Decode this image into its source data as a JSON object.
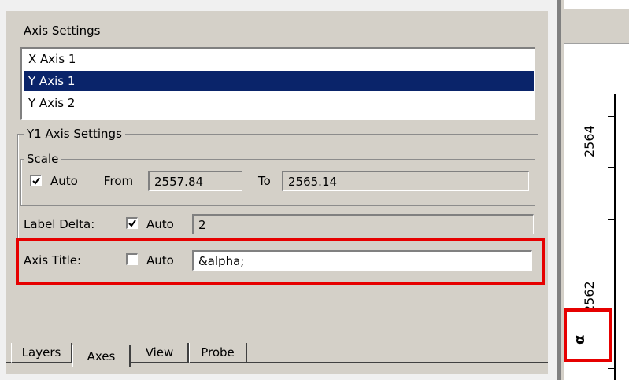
{
  "panel": {
    "title": "Axis Settings",
    "axis_list": [
      {
        "label": "X Axis 1",
        "selected": false
      },
      {
        "label": "Y Axis 1",
        "selected": true
      },
      {
        "label": "Y Axis 2",
        "selected": false
      }
    ]
  },
  "y1_settings": {
    "group_title": "Y1 Axis Settings",
    "scale": {
      "group_title": "Scale",
      "auto_label": "Auto",
      "auto_checked": true,
      "from_label": "From",
      "from_value": "2557.84",
      "to_label": "To",
      "to_value": "2565.14"
    },
    "label_delta": {
      "label": "Label Delta:",
      "auto_label": "Auto",
      "auto_checked": true,
      "value": "2"
    },
    "axis_title": {
      "label": "Axis Title:",
      "auto_label": "Auto",
      "auto_checked": false,
      "value": "&alpha;"
    }
  },
  "tabs": [
    {
      "label": "Layers",
      "active": false
    },
    {
      "label": "Axes",
      "active": true
    },
    {
      "label": "View",
      "active": false
    },
    {
      "label": "Probe",
      "active": false
    }
  ],
  "plot": {
    "tick_labels": [
      "2564",
      "2562"
    ],
    "axis_title_glyph": "α"
  },
  "colors": {
    "selection": "#0a246a",
    "highlight": "#e60000",
    "window_face": "#d4d0c8"
  }
}
